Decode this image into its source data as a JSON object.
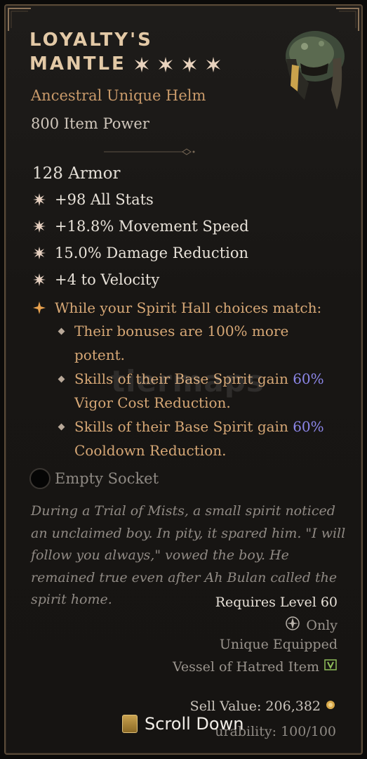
{
  "item": {
    "title_line1": "LOYALTY'S",
    "title_line2": "MANTLE",
    "subtype": "Ancestral Unique Helm",
    "power": "800 Item Power",
    "armor": "128 Armor",
    "stats": [
      "+98 All Stats",
      "+18.8% Movement Speed",
      "15.0% Damage Reduction",
      "+4 to Velocity"
    ],
    "unique_power": {
      "intro": "While your Spirit Hall choices match:",
      "bonus1": "Their bonuses are 100% more potent.",
      "bonus2_pre": "Skills of their Base Spirit gain ",
      "bonus2_value": "60%",
      "bonus2_post": " Vigor Cost Reduction.",
      "bonus3_pre": "Skills of their Base Spirit gain ",
      "bonus3_value": "60%",
      "bonus3_post": " Cooldown Reduction."
    },
    "socket": "Empty Socket",
    "flavor": "During a Trial of Mists, a small spirit noticed an unclaimed boy. In pity, it spared him. \"I will follow you always,\" vowed the boy. He remained true even after Ah Bulan called the spirit home.",
    "requirements": {
      "level": "Requires Level 60",
      "class_only": "Only",
      "unique_equipped": "Unique Equipped",
      "vessel": "Vessel of Hatred Item"
    },
    "sell_value": "Sell Value: 206,382",
    "durability": "urability: 100/100"
  },
  "scroll_hint": "Scroll Down",
  "watermark": "tiermaps",
  "colors": {
    "title": "#e3c9a6",
    "subtype": "#c99a6a",
    "unique": "#d7a876",
    "highlight": "#8c86e8",
    "border": "#5a4a38"
  },
  "icons": {
    "affix_bullet": "asterisk-gem-icon",
    "unique_bullet": "orange-star-icon",
    "rarity_star": "rarity-star-icon",
    "socket": "socket-ring-icon",
    "class": "spiritborn-class-icon",
    "expansion": "vessel-of-hatred-icon",
    "gold": "gold-coin-icon",
    "scroll_key": "scroll-key-icon"
  }
}
